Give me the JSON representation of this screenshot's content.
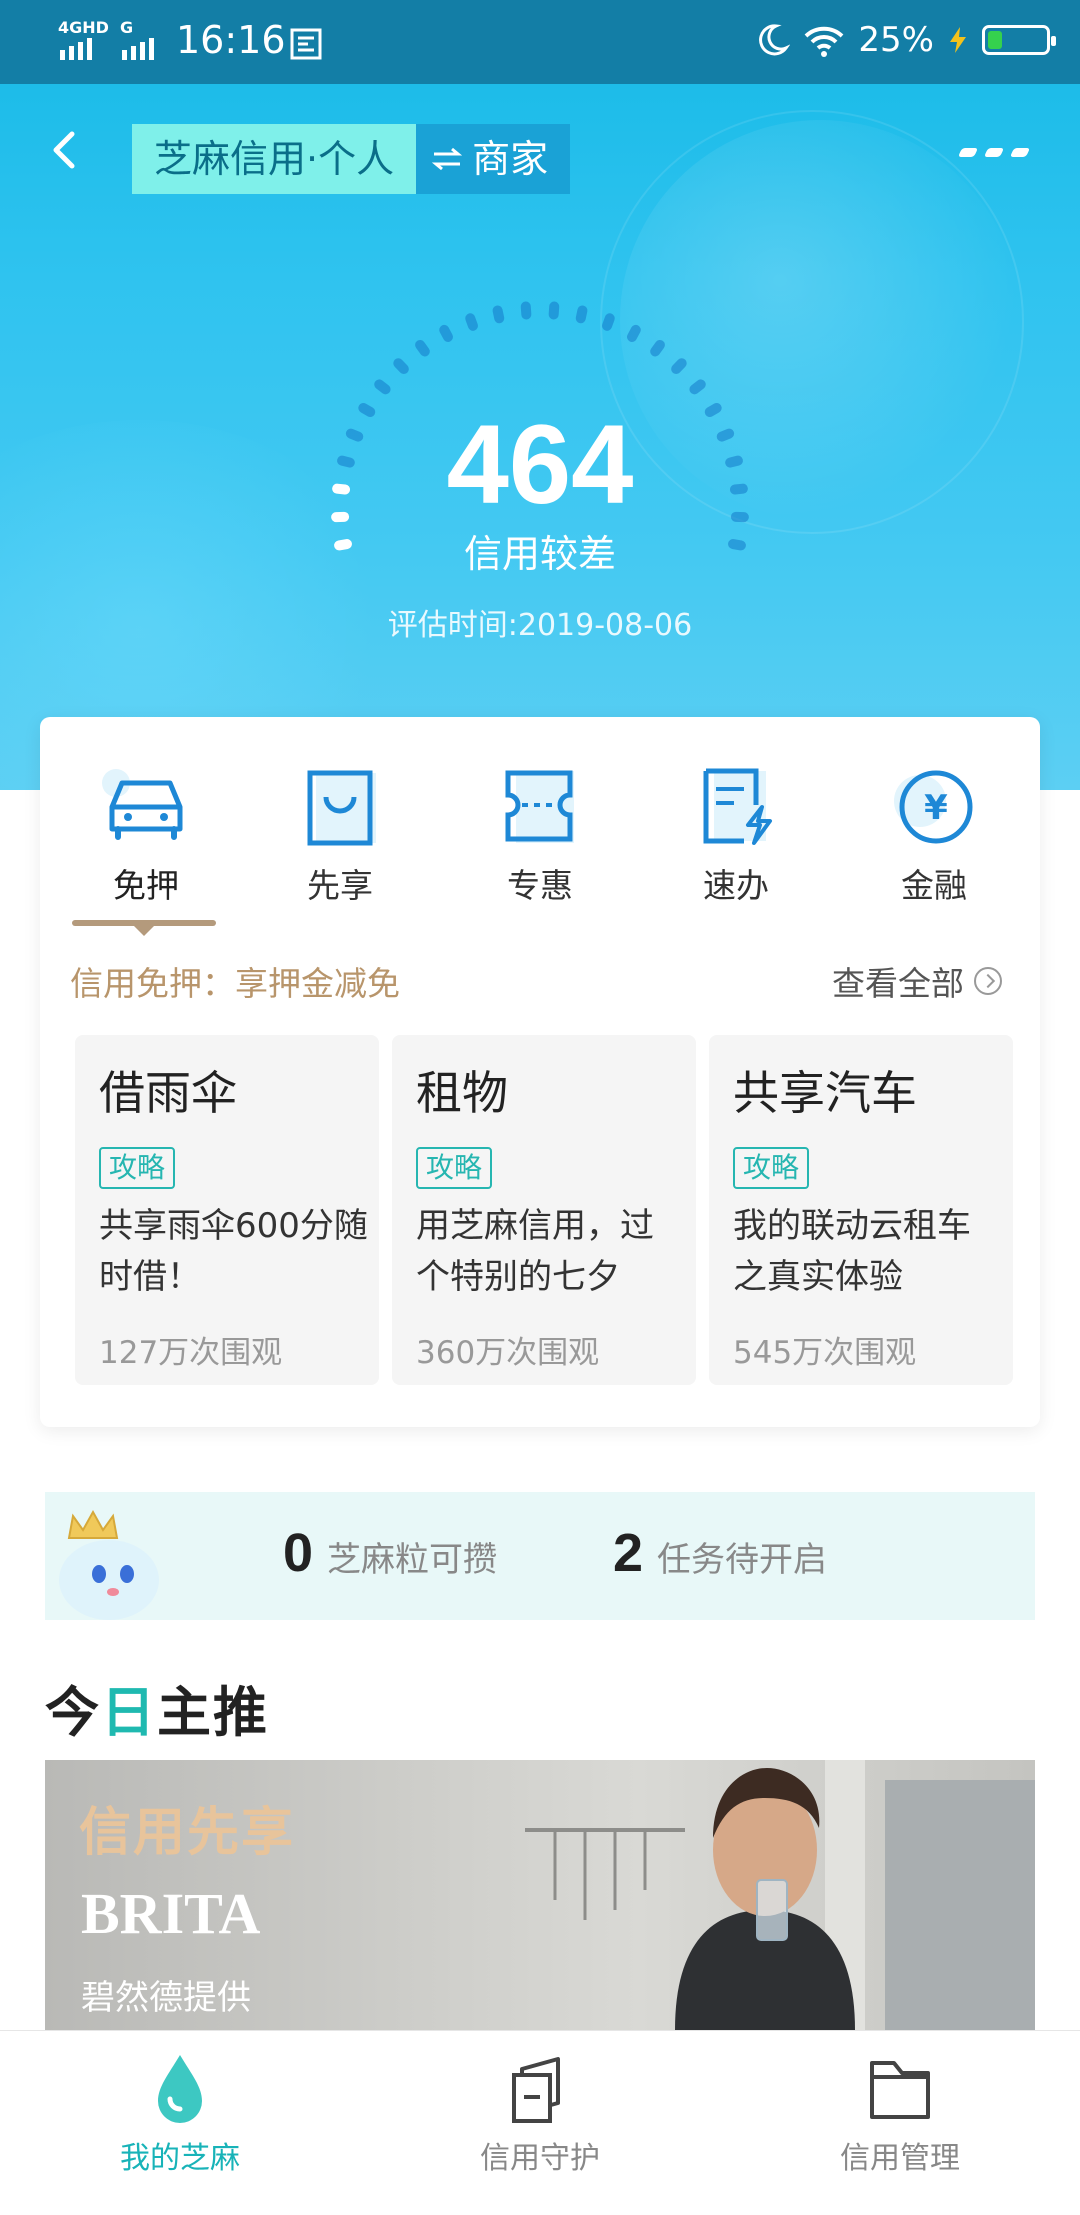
{
  "status_bar": {
    "network1": "4GHD",
    "network2": "G",
    "time": "16:16",
    "battery_pct": "25%",
    "battery_level": 0.25
  },
  "header": {
    "back_icon": "back-arrow-icon",
    "tab_personal": "芝麻信用·个人",
    "switch_icon": "swap-icon",
    "tab_merchant": "商家",
    "more_icon": "more-icon"
  },
  "score": {
    "value": "464",
    "grade": "信用较差",
    "eval_date": "评估时间:2019-08-06"
  },
  "categories": [
    {
      "label": "免押",
      "icon": "car-icon"
    },
    {
      "label": "先享",
      "icon": "bag-icon"
    },
    {
      "label": "专惠",
      "icon": "coupon-icon"
    },
    {
      "label": "速办",
      "icon": "document-lightning-icon"
    },
    {
      "label": "金融",
      "icon": "yuan-icon"
    }
  ],
  "category_tip": {
    "left": "信用免押：享押金减免",
    "right": "查看全部"
  },
  "tiles": [
    {
      "title": "借雨伞",
      "tag": "攻略",
      "desc": "共享雨伞600分随时借！",
      "views": "127万次围观"
    },
    {
      "title": "租物",
      "tag": "攻略",
      "desc": "用芝麻信用，过个特别的七夕",
      "views": "360万次围观"
    },
    {
      "title": "共享汽车",
      "tag": "攻略",
      "desc": "我的联动云租车之真实体验",
      "views": "545万次围观"
    }
  ],
  "sesame_strip": {
    "count1": "0",
    "label1": "芝麻粒可攒",
    "count2": "2",
    "label2": "任务待开启"
  },
  "section_title": {
    "part1": "今",
    "part2": "日",
    "part3": "主推"
  },
  "banner": {
    "tag": "信用先享",
    "brand": "BRITA",
    "provider": "碧然德提供"
  },
  "tabbar": [
    {
      "label": "我的芝麻",
      "icon": "sesame-drop-icon",
      "active": true
    },
    {
      "label": "信用守护",
      "icon": "shield-box-icon",
      "active": false
    },
    {
      "label": "信用管理",
      "icon": "folder-icon",
      "active": false
    }
  ],
  "colors": {
    "hero": "#2fc3ef",
    "accent_teal": "#18b3b8",
    "tip_gold": "#b8956b"
  }
}
